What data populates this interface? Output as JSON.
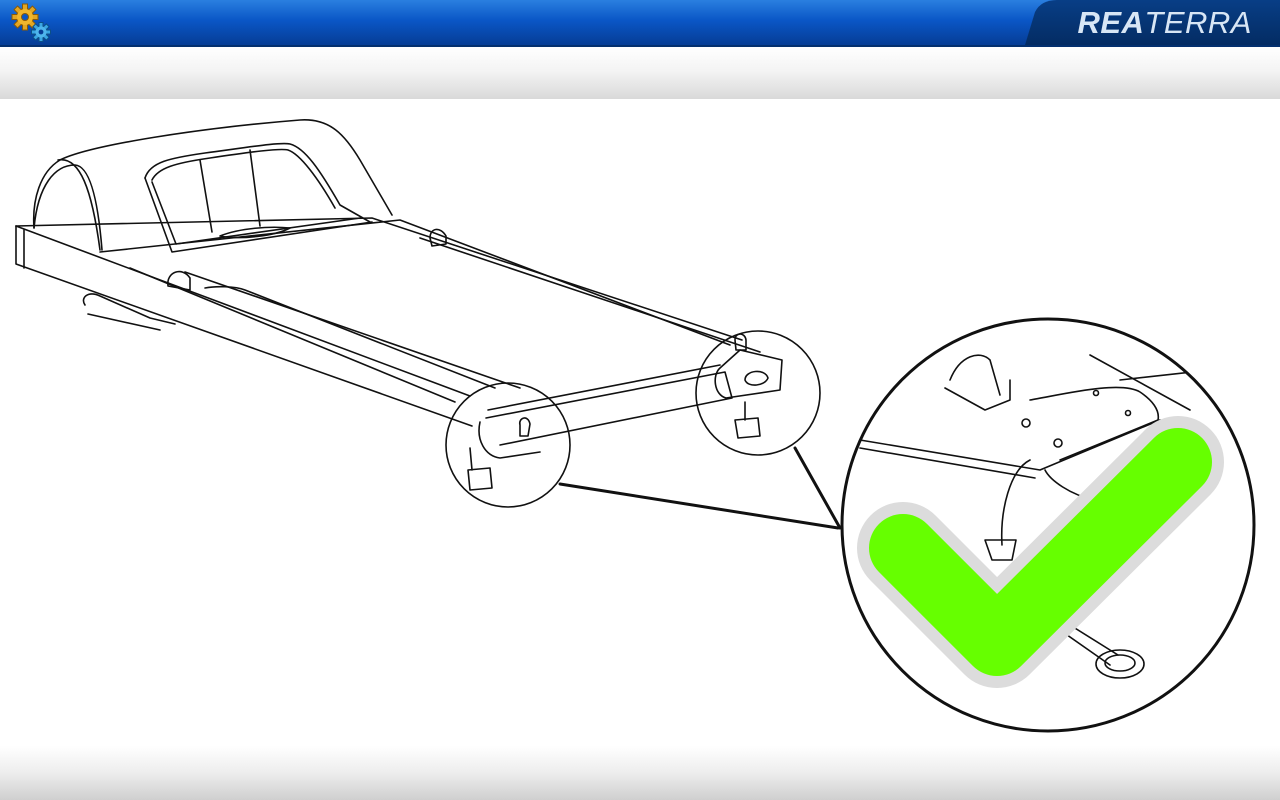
{
  "header": {
    "brand_part1": "REA",
    "brand_part2": "TERRA",
    "settings_icon": "gears-icon",
    "colors": {
      "bar_top": "#2a7fe0",
      "bar_bottom": "#063d95",
      "brand_text": "#d8e6f5",
      "gear_gold": "#e2a623",
      "gear_blue": "#3aa7e4"
    }
  },
  "illustration": {
    "subject": "treadmill-frame-with-leveling-feet",
    "check_icon": "checkmark-icon",
    "colors": {
      "check": "#66ff00",
      "check_outline": "#dcdcdc",
      "lines": "#111111"
    }
  }
}
